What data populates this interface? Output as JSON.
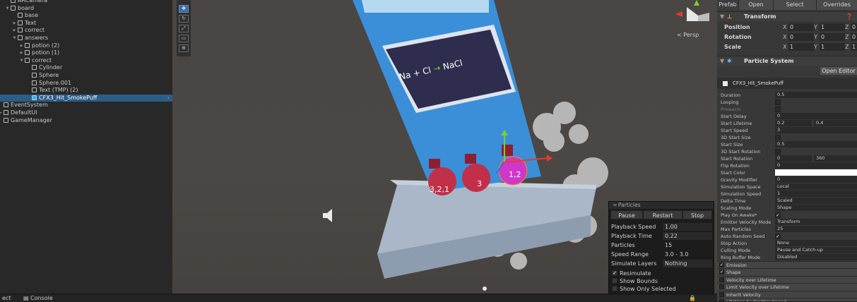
{
  "hierarchy": {
    "rows": [
      {
        "label": "ARCamera",
        "indent": 1,
        "arrow": "",
        "type": "go"
      },
      {
        "label": "board",
        "indent": 1,
        "arrow": "▼",
        "type": "go"
      },
      {
        "label": "base",
        "indent": 2,
        "arrow": "",
        "type": "go"
      },
      {
        "label": "Text",
        "indent": 2,
        "arrow": "▶",
        "type": "go"
      },
      {
        "label": "correct",
        "indent": 2,
        "arrow": "▶",
        "type": "go"
      },
      {
        "label": "answers",
        "indent": 2,
        "arrow": "▼",
        "type": "go"
      },
      {
        "label": "potion (2)",
        "indent": 3,
        "arrow": "▶",
        "type": "go"
      },
      {
        "label": "potion (1)",
        "indent": 3,
        "arrow": "▶",
        "type": "go"
      },
      {
        "label": "correct",
        "indent": 3,
        "arrow": "▼",
        "type": "go"
      },
      {
        "label": "Cylinder",
        "indent": 4,
        "arrow": "",
        "type": "go"
      },
      {
        "label": "Sphere",
        "indent": 4,
        "arrow": "",
        "type": "go"
      },
      {
        "label": "Sphere.001",
        "indent": 4,
        "arrow": "",
        "type": "go"
      },
      {
        "label": "Text (TMP) (2)",
        "indent": 4,
        "arrow": "",
        "type": "go"
      },
      {
        "label": "CFX3_Hit_SmokePuff",
        "indent": 4,
        "arrow": "",
        "type": "prefab",
        "selected": true
      },
      {
        "label": "EventSystem",
        "indent": 0,
        "arrow": "",
        "type": "go"
      },
      {
        "label": "DefaultUI",
        "indent": 0,
        "arrow": "▶",
        "type": "go"
      },
      {
        "label": "GameManager",
        "indent": 0,
        "arrow": "",
        "type": "go"
      }
    ]
  },
  "scene": {
    "persp_label": "< Persp",
    "formula": {
      "na": "Na",
      "plus": "+",
      "cl": "Cl",
      "nacl": "NaCl"
    },
    "potions": [
      "3,2,1",
      "3",
      "1,2"
    ],
    "colors": {
      "screen_blue": "#3a8fd8",
      "potion_red": "#c22f48",
      "potion_magenta": "#d036c9",
      "selection": "#ff8a00"
    }
  },
  "particles": {
    "title": "Particles",
    "pause": "Pause",
    "restart": "Restart",
    "stop": "Stop",
    "rows": [
      {
        "label": "Playback Speed",
        "value": "1.00",
        "boxed": true
      },
      {
        "label": "Playback Time",
        "value": "0.22",
        "boxed": true
      },
      {
        "label": "Particles",
        "value": "15",
        "boxed": false
      },
      {
        "label": "Speed Range",
        "value": "3.0 - 3.0",
        "boxed": false
      },
      {
        "label": "Simulate Layers",
        "value": "Nothing",
        "boxed": true
      }
    ],
    "checks": [
      {
        "label": "Resimulate",
        "checked": true
      },
      {
        "label": "Show Bounds",
        "checked": false
      },
      {
        "label": "Show Only Selected",
        "checked": false
      }
    ]
  },
  "inspector": {
    "top": {
      "prefab": "Prefab",
      "open": "Open",
      "select": "Select",
      "overrides": "Overrides"
    },
    "transform": {
      "title": "Transform",
      "position": {
        "label": "Position",
        "x": "0",
        "y": "1",
        "z": "0"
      },
      "rotation": {
        "label": "Rotation",
        "x": "0",
        "y": "0",
        "z": "0"
      },
      "scale": {
        "label": "Scale",
        "x": "1",
        "y": "1",
        "z": "1"
      }
    },
    "particle_system": {
      "title": "Particle System",
      "open_editor": "Open Editor",
      "name": "CFX3_Hit_SmokePuff",
      "props": [
        {
          "k": "Duration",
          "v": "0.5"
        },
        {
          "k": "Looping",
          "chk": false
        },
        {
          "k": "Prewarm",
          "chk": false,
          "dim": true
        },
        {
          "k": "Start Delay",
          "v": "0"
        },
        {
          "k": "Start Lifetime",
          "v": "0.2",
          "v2": "0.4"
        },
        {
          "k": "Start Speed",
          "v": "3"
        },
        {
          "k": "3D Start Size",
          "chk": false
        },
        {
          "k": "Start Size",
          "v": "0.5"
        },
        {
          "k": "3D Start Rotation",
          "chk": false
        },
        {
          "k": "Start Rotation",
          "v": "0",
          "v2": "360"
        },
        {
          "k": "Flip Rotation",
          "v": "0"
        },
        {
          "k": "Start Color",
          "color": "#ffffff"
        },
        {
          "k": "Gravity Modifier",
          "v": "0"
        },
        {
          "k": "Simulation Space",
          "v": "Local"
        },
        {
          "k": "Simulation Speed",
          "v": "1"
        },
        {
          "k": "Delta Time",
          "v": "Scaled"
        },
        {
          "k": "Scaling Mode",
          "v": "Shape"
        },
        {
          "k": "Play On Awake*",
          "chk": true
        },
        {
          "k": "Emitter Velocity Mode",
          "v": "Transform"
        },
        {
          "k": "Max Particles",
          "v": "25"
        },
        {
          "k": "Auto Random Seed",
          "chk": true
        },
        {
          "k": "Stop Action",
          "v": "None"
        },
        {
          "k": "Culling Mode",
          "v": "Pause and Catch-up"
        },
        {
          "k": "Ring Buffer Mode",
          "v": "Disabled"
        }
      ],
      "modules": [
        {
          "label": "Emission",
          "checked": true
        },
        {
          "label": "Shape",
          "checked": true
        },
        {
          "label": "Velocity over Lifetime",
          "checked": false
        },
        {
          "label": "Limit Velocity over Lifetime",
          "checked": false
        },
        {
          "label": "Inherit Velocity",
          "checked": false
        },
        {
          "label": "Lifetime by Emitter Speed",
          "checked": false
        }
      ]
    }
  },
  "bottombar": {
    "project": "ect",
    "console": "Console"
  }
}
